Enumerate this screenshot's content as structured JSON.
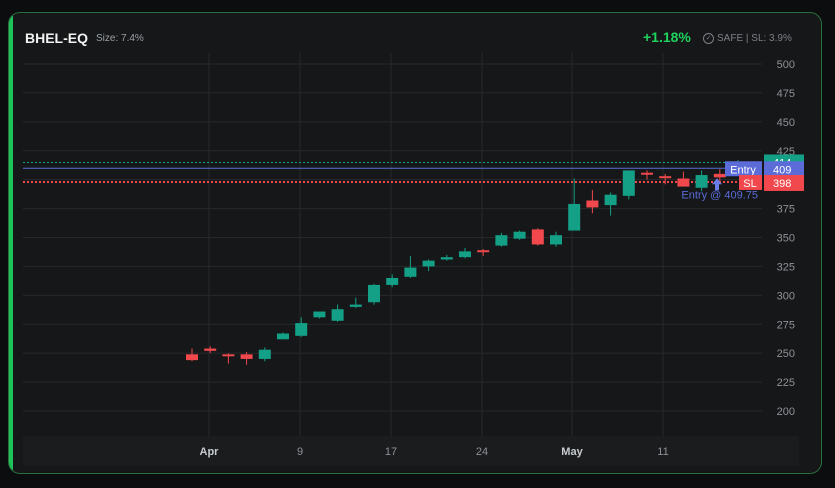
{
  "header": {
    "ticker": "BHEL-EQ",
    "size": "Size: 7.4%",
    "change": "+1.18%",
    "safe": "SAFE | SL: 3.9%"
  },
  "chart_data": {
    "type": "candlestick",
    "y_ticks": [
      500,
      475,
      450,
      425,
      400,
      375,
      350,
      325,
      300,
      275,
      250,
      225,
      200
    ],
    "ylim": [
      187,
      510
    ],
    "x_ticks": [
      "Apr",
      "9",
      "17",
      "24",
      "May",
      "11"
    ],
    "candles": [
      {
        "o": 249,
        "h": 254,
        "l": 243,
        "c": 244
      },
      {
        "o": 254,
        "h": 256,
        "l": 250,
        "c": 252
      },
      {
        "o": 249,
        "h": 250,
        "l": 241,
        "c": 248
      },
      {
        "o": 249,
        "h": 251,
        "l": 240,
        "c": 245
      },
      {
        "o": 245,
        "h": 255,
        "l": 243,
        "c": 253
      },
      {
        "o": 262,
        "h": 268,
        "l": 262,
        "c": 267
      },
      {
        "o": 265,
        "h": 281,
        "l": 264,
        "c": 276
      },
      {
        "o": 281,
        "h": 285,
        "l": 280,
        "c": 286
      },
      {
        "o": 278,
        "h": 292,
        "l": 277,
        "c": 288
      },
      {
        "o": 290,
        "h": 298,
        "l": 289,
        "c": 292
      },
      {
        "o": 294,
        "h": 310,
        "l": 292,
        "c": 309
      },
      {
        "o": 309,
        "h": 318,
        "l": 307,
        "c": 315
      },
      {
        "o": 316,
        "h": 334,
        "l": 315,
        "c": 324
      },
      {
        "o": 325,
        "h": 331,
        "l": 321,
        "c": 330
      },
      {
        "o": 331,
        "h": 335,
        "l": 330,
        "c": 333
      },
      {
        "o": 333,
        "h": 341,
        "l": 332,
        "c": 338
      },
      {
        "o": 339,
        "h": 340,
        "l": 334,
        "c": 338
      },
      {
        "o": 343,
        "h": 354,
        "l": 342,
        "c": 352
      },
      {
        "o": 349,
        "h": 356,
        "l": 348,
        "c": 355
      },
      {
        "o": 357,
        "h": 358,
        "l": 343,
        "c": 344
      },
      {
        "o": 344,
        "h": 355,
        "l": 342,
        "c": 352
      },
      {
        "o": 356,
        "h": 401,
        "l": 356,
        "c": 379
      },
      {
        "o": 382,
        "h": 391,
        "l": 371,
        "c": 376
      },
      {
        "o": 378,
        "h": 389,
        "l": 369,
        "c": 387
      },
      {
        "o": 386,
        "h": 408,
        "l": 383,
        "c": 408
      },
      {
        "o": 406,
        "h": 408,
        "l": 400,
        "c": 405
      },
      {
        "o": 403,
        "h": 405,
        "l": 396,
        "c": 402
      },
      {
        "o": 401,
        "h": 407,
        "l": 395,
        "c": 394
      },
      {
        "o": 393,
        "h": 408,
        "l": 390,
        "c": 404
      },
      {
        "o": 405,
        "h": 409,
        "l": 398,
        "c": 402
      },
      {
        "o": 406,
        "h": 417,
        "l": 405,
        "c": 414
      }
    ],
    "levels": {
      "current": {
        "value": 414,
        "label": "414",
        "color": "#14a087"
      },
      "entry": {
        "value": 409,
        "label": "409",
        "tag": "Entry",
        "color": "#5b6bd8"
      },
      "sl": {
        "value": 398,
        "label": "398",
        "tag": "SL",
        "color": "#f0484c"
      }
    },
    "annotation": "Entry @ 409.75"
  },
  "colors": {
    "up": "#14a087",
    "down": "#f0484c",
    "grid": "#26282a",
    "axis_text": "#8d9298",
    "accent": "#1fc35a"
  }
}
